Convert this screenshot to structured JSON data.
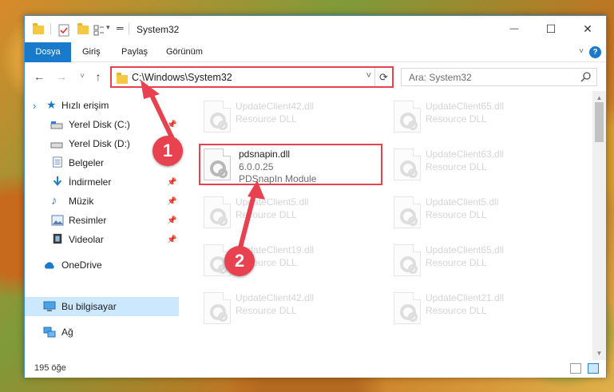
{
  "window": {
    "title": "System32",
    "controls": {
      "minimize": "—",
      "maximize": "☐",
      "close": "✕"
    }
  },
  "ribbon": {
    "tabs": [
      "Dosya",
      "Giriş",
      "Paylaş",
      "Görünüm"
    ],
    "help": "?"
  },
  "address": {
    "path": "C:\\Windows\\System32",
    "search_placeholder": "Ara: System32"
  },
  "nav": {
    "back": "←",
    "forward": "→",
    "recent": "˅",
    "up": "↑"
  },
  "sidebar": {
    "items": [
      {
        "label": "Hızlı erişim",
        "icon": "star-icon"
      },
      {
        "label": "Yerel Disk (C:)",
        "icon": "drive-icon",
        "pinned": true
      },
      {
        "label": "Yerel Disk (D:)",
        "icon": "drive-icon",
        "pinned": true
      },
      {
        "label": "Belgeler",
        "icon": "documents-icon",
        "pinned": true
      },
      {
        "label": "İndirmeler",
        "icon": "download-icon",
        "pinned": true
      },
      {
        "label": "Müzik",
        "icon": "music-icon",
        "pinned": true
      },
      {
        "label": "Resimler",
        "icon": "pictures-icon",
        "pinned": true
      },
      {
        "label": "Videolar",
        "icon": "videos-icon",
        "pinned": true
      },
      {
        "label": "OneDrive",
        "icon": "onedrive-icon"
      },
      {
        "label": "Bu bilgisayar",
        "icon": "computer-icon",
        "selected": true
      },
      {
        "label": "Ağ",
        "icon": "network-icon"
      }
    ],
    "pin_glyph": "📌"
  },
  "files": {
    "highlighted": {
      "name": "pdsnapin.dll",
      "version": "6.0.0.25",
      "description": "PDSnapIn Module"
    },
    "left_column": [
      {
        "name": "UpdateClient42.dll",
        "description": "Resource DLL"
      },
      {
        "name": "UpdateClient5.dll",
        "description": "Resource DLL"
      },
      {
        "name": "UpdateClient19.dll",
        "description": "Resource DLL"
      },
      {
        "name": "UpdateClient42.dll",
        "description": "Resource DLL"
      }
    ],
    "right_column": [
      {
        "name": "UpdateClient65.dll",
        "description": "Resource DLL"
      },
      {
        "name": "UpdateClient63.dll",
        "description": "Resource DLL"
      },
      {
        "name": "UpdateClient5.dll",
        "description": "Resource DLL"
      },
      {
        "name": "UpdateClient65.dll",
        "description": "Resource DLL"
      },
      {
        "name": "UpdateClient21.dll",
        "description": "Resource DLL"
      }
    ]
  },
  "status": {
    "item_count": "195 öğe"
  },
  "callouts": {
    "step1": "1",
    "step2": "2"
  },
  "colors": {
    "accent": "#1979ca",
    "highlight": "#e8414f",
    "selection": "#cce8ff"
  }
}
